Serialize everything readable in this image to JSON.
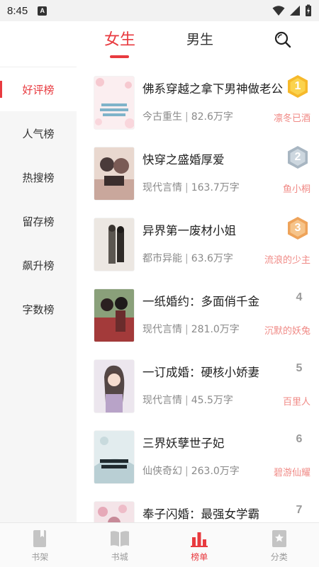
{
  "status_bar": {
    "time": "8:45",
    "badge": "A"
  },
  "header": {
    "tabs": [
      {
        "label": "女生",
        "active": true
      },
      {
        "label": "男生",
        "active": false
      }
    ]
  },
  "sidebar": {
    "items": [
      {
        "label": "好评榜",
        "active": true
      },
      {
        "label": "人气榜",
        "active": false
      },
      {
        "label": "热搜榜",
        "active": false
      },
      {
        "label": "留存榜",
        "active": false
      },
      {
        "label": "飙升榜",
        "active": false
      },
      {
        "label": "字数榜",
        "active": false
      }
    ]
  },
  "books": [
    {
      "rank": "1",
      "title": "佛系穿越之拿下男神做老公",
      "category": "今古重生",
      "words": "82.6万字",
      "author": "凛冬已酒",
      "medal": "gold"
    },
    {
      "rank": "2",
      "title": "快穿之盛婚厚爱",
      "category": "现代言情",
      "words": "163.7万字",
      "author": "鱼小桐",
      "medal": "silver"
    },
    {
      "rank": "3",
      "title": "异界第一废材小姐",
      "category": "都市异能",
      "words": "63.6万字",
      "author": "流浪的少主",
      "medal": "bronze"
    },
    {
      "rank": "4",
      "title": "一纸婚约：多面俏千金",
      "category": "现代言情",
      "words": "281.0万字",
      "author": "沉默的妖兔",
      "medal": ""
    },
    {
      "rank": "5",
      "title": "一订成婚：硬核小娇妻",
      "category": "现代言情",
      "words": "45.5万字",
      "author": "百里人",
      "medal": ""
    },
    {
      "rank": "6",
      "title": "三界妖孽世子妃",
      "category": "仙侠奇幻",
      "words": "263.0万字",
      "author": "碧游仙耀",
      "medal": ""
    },
    {
      "rank": "7",
      "title": "奉子闪婚：最强女学霸",
      "category": "",
      "words": "",
      "author": "",
      "medal": ""
    }
  ],
  "bottom_nav": [
    {
      "label": "书架",
      "icon": "bookshelf-icon",
      "active": false
    },
    {
      "label": "书城",
      "icon": "open-book-icon",
      "active": false
    },
    {
      "label": "榜单",
      "icon": "bar-chart-icon",
      "active": true
    },
    {
      "label": "分类",
      "icon": "star-bookmark-icon",
      "active": false
    }
  ],
  "colors": {
    "accent": "#e83a3f",
    "author": "#f08a86",
    "gold": "#f6b92b",
    "silver": "#a8b6c2",
    "bronze": "#eea35a"
  }
}
